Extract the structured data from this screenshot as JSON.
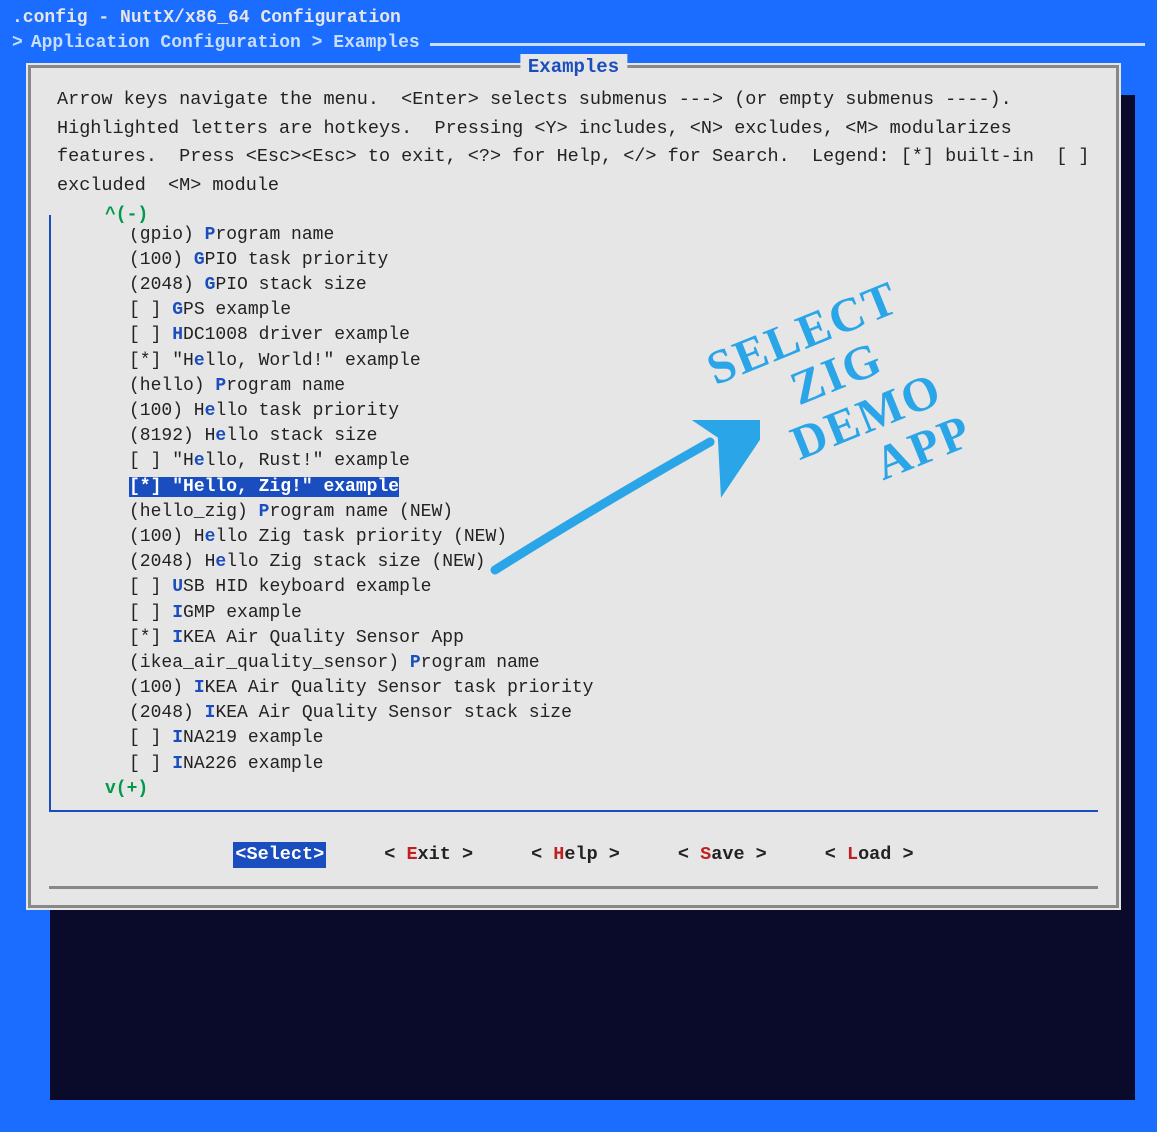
{
  "title": ".config - NuttX/x86_64 Configuration",
  "breadcrumb": "Application Configuration > Examples",
  "dialog_title": "Examples",
  "help_text": "Arrow keys navigate the menu.  <Enter> selects submenus ---> (or empty submenus ----).  Highlighted letters are hotkeys.  Pressing <Y> includes, <N> excludes, <M> modularizes features.  Press <Esc><Esc> to exit, <?> for Help, </> for Search.  Legend: [*] built-in  [ ] excluded  <M> module",
  "scroll_up": "^(-)",
  "scroll_down": "v(+)",
  "rows": [
    {
      "pre": "(gpio) ",
      "hk": "P",
      "rest": "rogram name"
    },
    {
      "pre": "(100) ",
      "hk": "G",
      "rest": "PIO task priority"
    },
    {
      "pre": "(2048) ",
      "hk": "G",
      "rest": "PIO stack size"
    },
    {
      "pre": "[ ] ",
      "hk": "G",
      "rest": "PS example"
    },
    {
      "pre": "[ ] ",
      "hk": "H",
      "rest": "DC1008 driver example"
    },
    {
      "pre": "[*] \"H",
      "hk": "e",
      "rest": "llo, World!\" example"
    },
    {
      "pre": "(hello) ",
      "hk": "P",
      "rest": "rogram name"
    },
    {
      "pre": "(100) H",
      "hk": "e",
      "rest": "llo task priority"
    },
    {
      "pre": "(8192) H",
      "hk": "e",
      "rest": "llo stack size"
    },
    {
      "pre": "[ ] \"H",
      "hk": "e",
      "rest": "llo, Rust!\" example"
    },
    {
      "pre": "[*] \"H",
      "hk": "e",
      "rest": "llo, Zig!\" example",
      "selected": true
    },
    {
      "pre": "(hello_zig) ",
      "hk": "P",
      "rest": "rogram name (NEW)"
    },
    {
      "pre": "(100) H",
      "hk": "e",
      "rest": "llo Zig task priority (NEW)"
    },
    {
      "pre": "(2048) H",
      "hk": "e",
      "rest": "llo Zig stack size (NEW)"
    },
    {
      "pre": "[ ] ",
      "hk": "U",
      "rest": "SB HID keyboard example"
    },
    {
      "pre": "[ ] ",
      "hk": "I",
      "rest": "GMP example"
    },
    {
      "pre": "[*] ",
      "hk": "I",
      "rest": "KEA Air Quality Sensor App"
    },
    {
      "pre": "(ikea_air_quality_sensor) ",
      "hk": "P",
      "rest": "rogram name"
    },
    {
      "pre": "(100) ",
      "hk": "I",
      "rest": "KEA Air Quality Sensor task priority"
    },
    {
      "pre": "(2048) ",
      "hk": "I",
      "rest": "KEA Air Quality Sensor stack size"
    },
    {
      "pre": "[ ] ",
      "hk": "I",
      "rest": "NA219 example"
    },
    {
      "pre": "[ ] ",
      "hk": "I",
      "rest": "NA226 example"
    }
  ],
  "buttons": {
    "select": "<Select>",
    "exit": {
      "pre": "< ",
      "hk": "E",
      "rest": "xit >"
    },
    "help": {
      "pre": "< ",
      "hk": "H",
      "rest": "elp >"
    },
    "save": {
      "pre": "< ",
      "hk": "S",
      "rest": "ave >"
    },
    "load": {
      "pre": "< ",
      "hk": "L",
      "rest": "oad >"
    }
  },
  "annotation": {
    "line1": "SELECT",
    "line2": "ZIG",
    "line3": "DEMO",
    "line4": "APP"
  }
}
